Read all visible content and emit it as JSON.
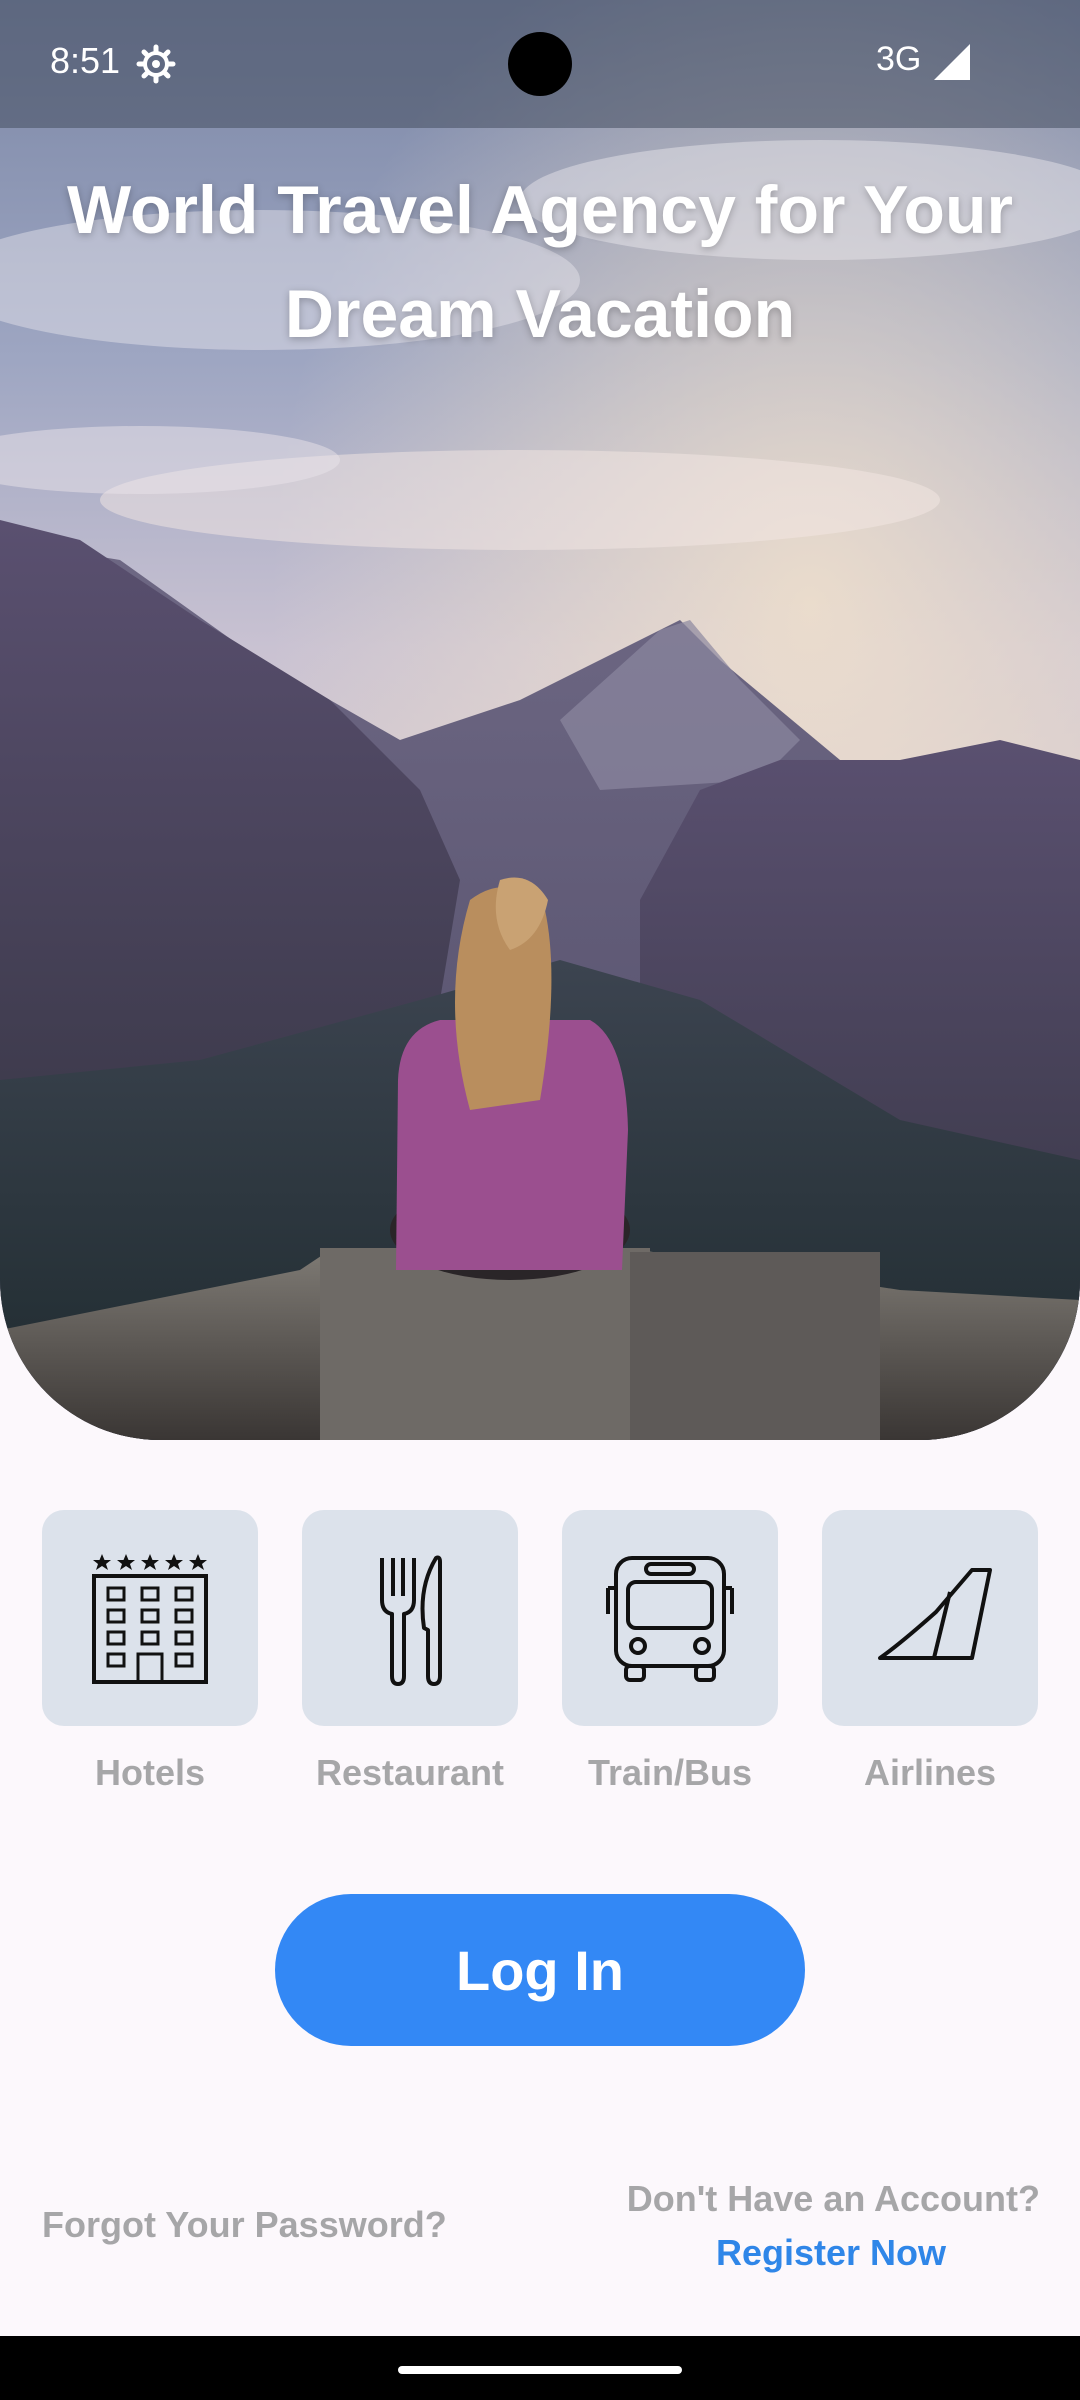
{
  "status_bar": {
    "time": "8:51",
    "network": "3G",
    "icons": [
      "gear-icon",
      "signal-icon"
    ]
  },
  "hero": {
    "title": "World Travel Agency for Your Dream Vacation",
    "image": "person-on-mountain-cliff"
  },
  "categories": [
    {
      "label": "Hotels",
      "icon": "hotel-icon"
    },
    {
      "label": "Restaurant",
      "icon": "restaurant-icon"
    },
    {
      "label": "Train/Bus",
      "icon": "bus-icon"
    },
    {
      "label": "Airlines",
      "icon": "airline-tail-icon"
    }
  ],
  "auth": {
    "login_label": "Log In",
    "forgot_password": "Forgot Your Password?",
    "no_account": "Don't Have an Account?",
    "register": "Register Now"
  },
  "colors": {
    "primary": "#3388F5",
    "link": "#2F86E8",
    "tile_bg": "#DCE2EB",
    "muted_text": "#A6A6A8",
    "background": "#FCF8FC"
  }
}
